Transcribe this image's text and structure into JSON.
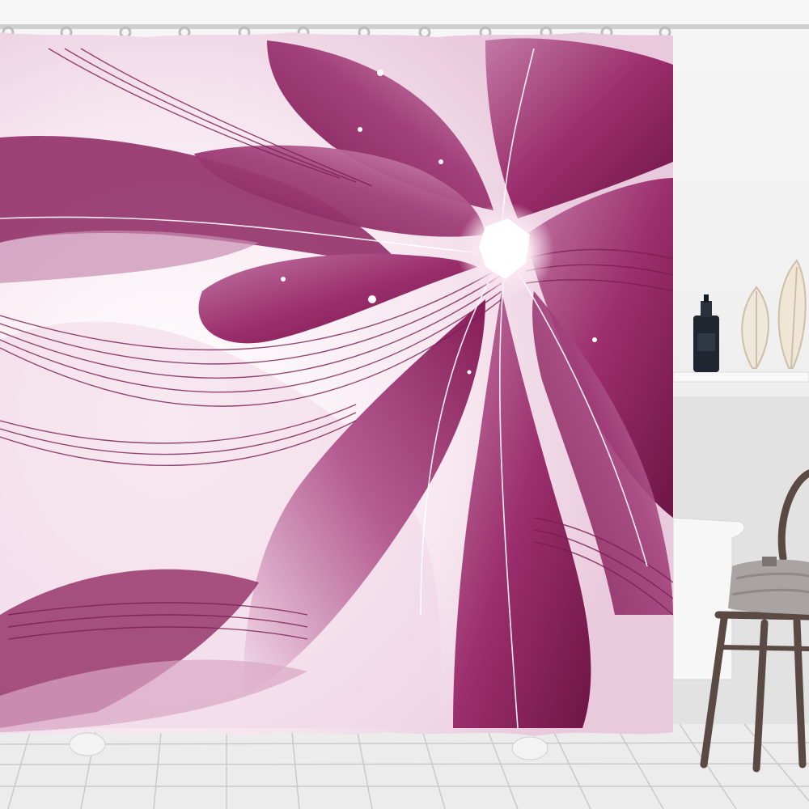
{
  "scene": {
    "subject": "floral-shower-curtain",
    "colors": {
      "wall": "#f1f1f1",
      "floor_tile": "#e6e6e6",
      "tile_line": "#c9c9c9",
      "curtain_light": "#fbf3f8",
      "petal_deep": "#8a1f5a",
      "petal_mid": "#b04c86",
      "petal_light": "#e4b6d3",
      "flower_center": "#ffffff",
      "rod": "#cfcfcf",
      "bottle": "#1f2630",
      "chair_wood": "#5b4a44",
      "towel": "#a9a4a1"
    },
    "icons": [
      "curtain-rod-icon",
      "soap-bottle-icon",
      "leaf-decor-icon",
      "chair-icon",
      "towel-icon",
      "bathtub-icon"
    ]
  }
}
